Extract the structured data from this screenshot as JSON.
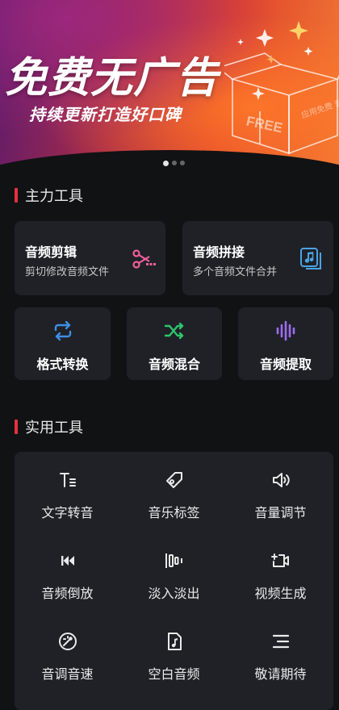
{
  "banner": {
    "title": "免费无广告",
    "subtitle": "持续更新打造好口碑",
    "box_label": "FREE",
    "box_side_text": "应用免费 音频剪辑",
    "indicator": {
      "count": 3,
      "active_index": 0
    }
  },
  "main_tools": {
    "title": "主力工具",
    "cards": [
      {
        "title": "音频剪辑",
        "desc": "剪切修改音频文件",
        "icon": "scissors-icon"
      },
      {
        "title": "音频拼接",
        "desc": "多个音频文件合并",
        "icon": "music-files-icon"
      }
    ],
    "mini": [
      {
        "label": "格式转换",
        "icon": "convert-icon"
      },
      {
        "label": "音频混合",
        "icon": "shuffle-icon"
      },
      {
        "label": "音频提取",
        "icon": "waveform-icon"
      }
    ]
  },
  "utility_tools": {
    "title": "实用工具",
    "items": [
      {
        "label": "文字转音",
        "icon": "text-icon"
      },
      {
        "label": "音乐标签",
        "icon": "tag-icon"
      },
      {
        "label": "音量调节",
        "icon": "volume-icon"
      },
      {
        "label": "音频倒放",
        "icon": "rewind-icon"
      },
      {
        "label": "淡入淡出",
        "icon": "fade-icon"
      },
      {
        "label": "视频生成",
        "icon": "video-icon"
      },
      {
        "label": "音调音速",
        "icon": "compass-icon"
      },
      {
        "label": "空白音频",
        "icon": "music-file-icon"
      },
      {
        "label": "敬请期待",
        "icon": "menu-lines-icon"
      }
    ]
  },
  "colors": {
    "background": "#111214",
    "card": "#1f2126",
    "accent": "#e8303e",
    "scissors": "#f0609a",
    "music_files": "#4aa3e6",
    "convert": "#3f8ee8",
    "shuffle": "#2fc46b",
    "waveform": "#9b6cf0"
  }
}
